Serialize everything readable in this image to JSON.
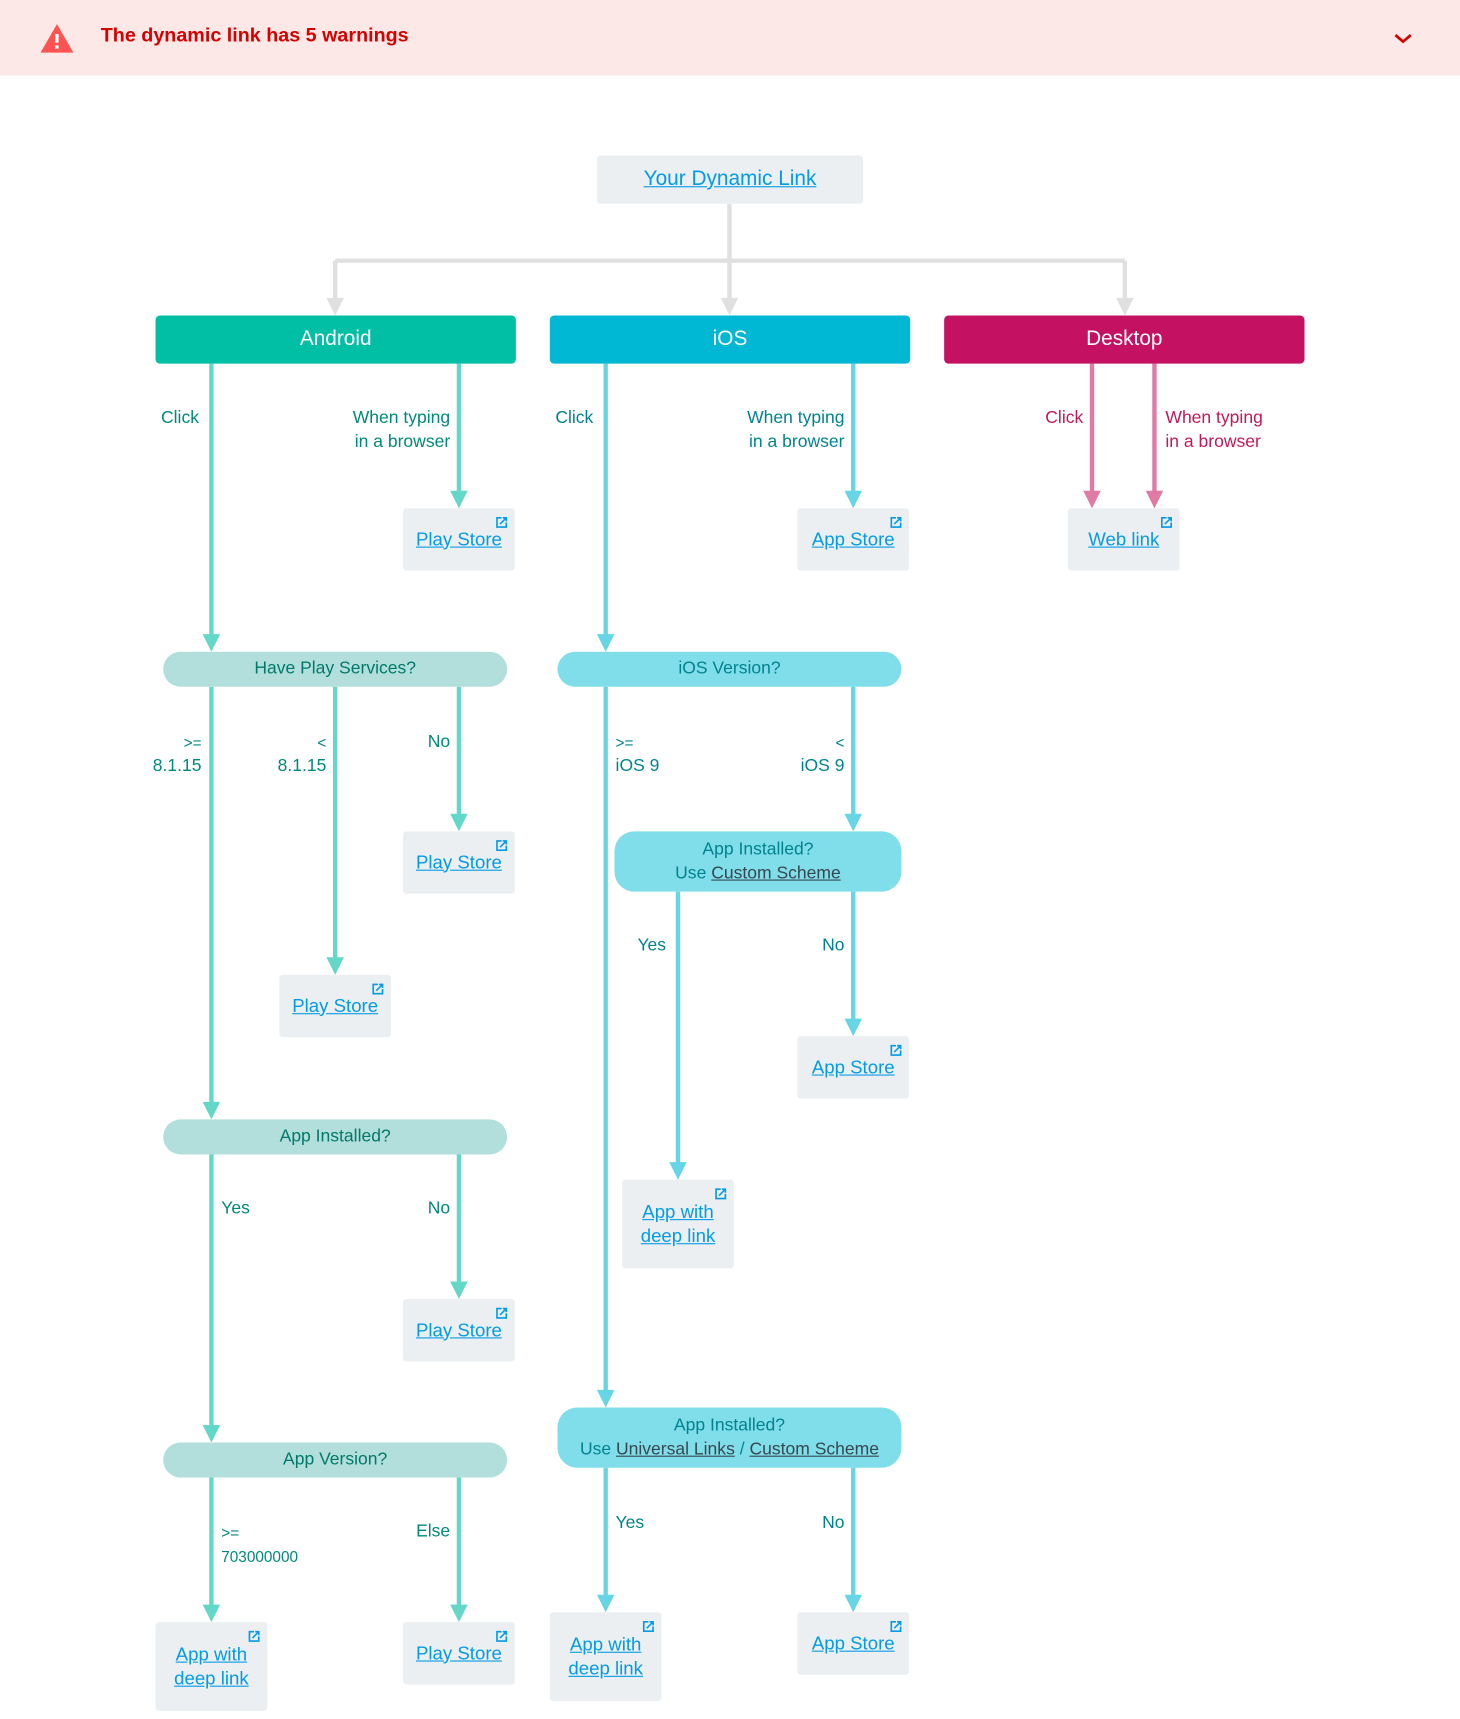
{
  "banner": {
    "title": "The dynamic link has 5 warnings",
    "icon": "warning-icon",
    "toggle_icon": "chevron-down-icon"
  },
  "root": {
    "label": "Your Dynamic Link"
  },
  "platforms": {
    "android": "Android",
    "ios": "iOS",
    "desktop": "Desktop"
  },
  "colors": {
    "android": "#00bfa5",
    "ios": "#00b8d4",
    "desktop": "#c51162",
    "warning": "#d50000"
  },
  "android": {
    "click": "Click",
    "typing": [
      "When typing",
      "in a browser"
    ],
    "typing_target": "Play Store",
    "play_services_q": "Have Play Services?",
    "ps_ge": [
      ">=",
      "8.1.15"
    ],
    "ps_lt": [
      "<",
      "8.1.15"
    ],
    "ps_no": "No",
    "ps_no_target": "Play Store",
    "ps_lt_target": "Play Store",
    "installed_q": "App Installed?",
    "installed_yes": "Yes",
    "installed_no": "No",
    "installed_no_target": "Play Store",
    "version_q": "App Version?",
    "version_ge": [
      ">=",
      "703000000"
    ],
    "version_else": "Else",
    "version_ge_target": [
      "App with",
      "deep link"
    ],
    "version_else_target": "Play Store"
  },
  "ios": {
    "click": "Click",
    "typing": [
      "When typing",
      "in a browser"
    ],
    "typing_target": "App Store",
    "version_q": "iOS Version?",
    "v_ge": [
      ">=",
      "iOS 9"
    ],
    "v_lt": [
      "<",
      "iOS 9"
    ],
    "custom_q": {
      "line1": "App Installed?",
      "prefix": "Use ",
      "link": "Custom Scheme"
    },
    "custom_yes": "Yes",
    "custom_no": "No",
    "custom_no_target": "App Store",
    "custom_yes_target": [
      "App with",
      "deep link"
    ],
    "universal_q": {
      "line1": "App Installed?",
      "prefix": "Use ",
      "link1": "Universal Links",
      "sep": " / ",
      "link2": "Custom Scheme"
    },
    "universal_yes": "Yes",
    "universal_no": "No",
    "universal_yes_target": [
      "App with",
      "deep link"
    ],
    "universal_no_target": "App Store"
  },
  "desktop": {
    "click": "Click",
    "typing": [
      "When typing",
      "in a browser"
    ],
    "target": "Web link"
  }
}
